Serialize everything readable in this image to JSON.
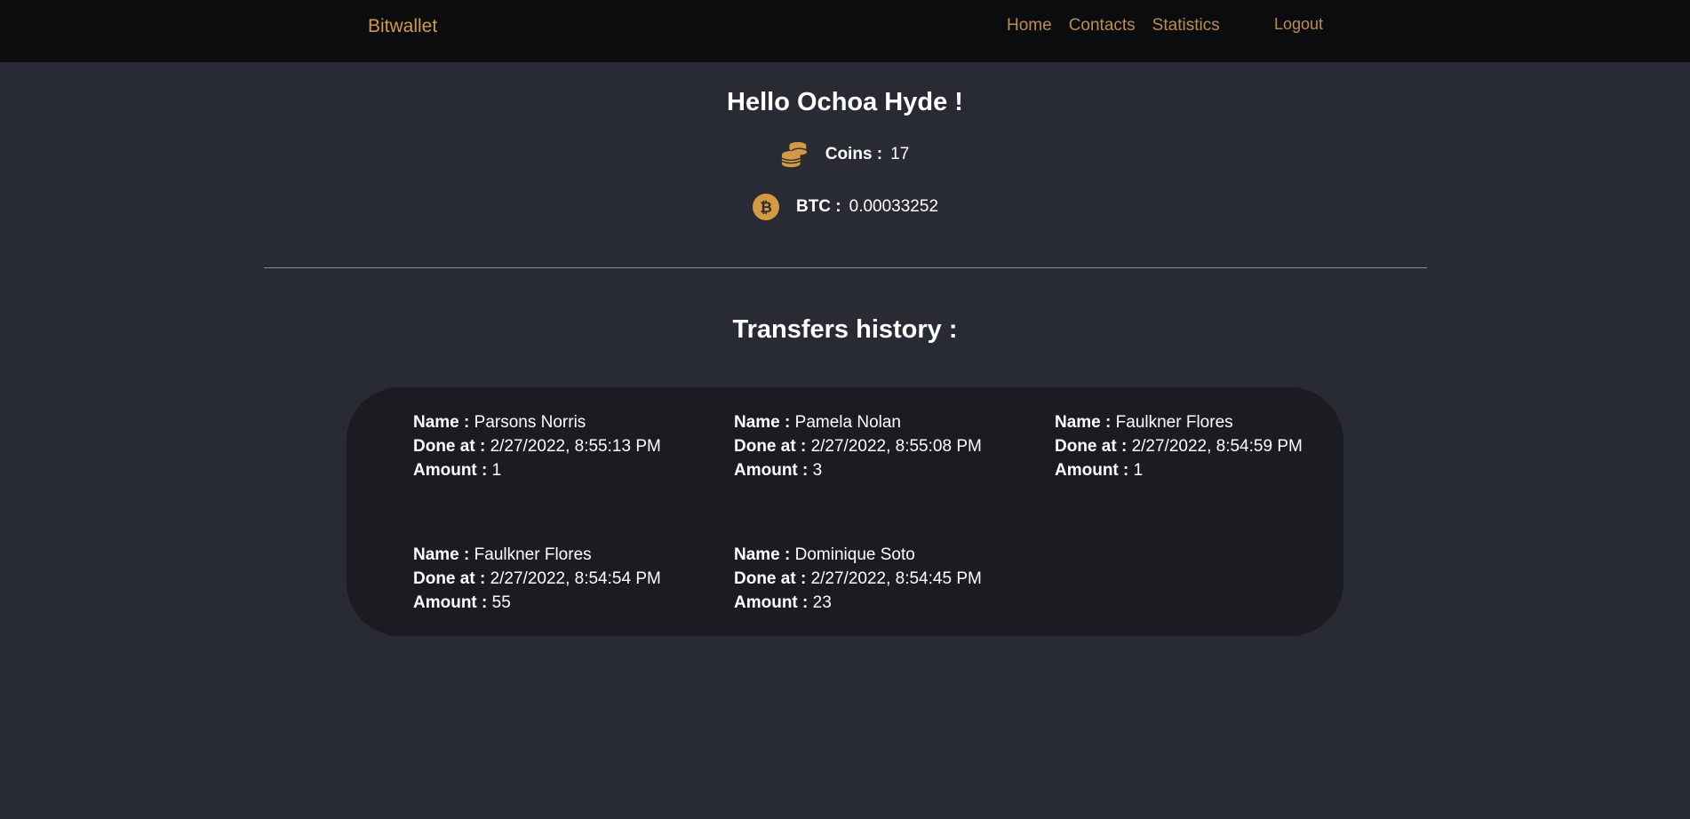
{
  "navbar": {
    "brand": "Bitwallet",
    "links": [
      "Home",
      "Contacts",
      "Statistics"
    ],
    "logout": "Logout"
  },
  "greeting": "Hello Ochoa Hyde !",
  "balance": {
    "coins_label": "Coins :",
    "coins_value": "17",
    "btc_label": "BTC :",
    "btc_value": "0.00033252"
  },
  "transfers": {
    "title": "Transfers history :",
    "name_label": "Name :",
    "done_label": "Done at :",
    "amount_label": "Amount :",
    "items": [
      {
        "name": "Parsons Norris",
        "done_at": "2/27/2022, 8:55:13 PM",
        "amount": "1"
      },
      {
        "name": "Pamela Nolan",
        "done_at": "2/27/2022, 8:55:08 PM",
        "amount": "3"
      },
      {
        "name": "Faulkner Flores",
        "done_at": "2/27/2022, 8:54:59 PM",
        "amount": "1"
      },
      {
        "name": "Faulkner Flores",
        "done_at": "2/27/2022, 8:54:54 PM",
        "amount": "55"
      },
      {
        "name": "Dominique Soto",
        "done_at": "2/27/2022, 8:54:45 PM",
        "amount": "23"
      }
    ]
  },
  "colors": {
    "background": "#282b33",
    "navbar": "#0b0c0e",
    "accent": "#d49a3f",
    "panel": "#1a1c22"
  },
  "icons": {
    "coins": "coins-stack-icon",
    "btc": "bitcoin-icon"
  }
}
